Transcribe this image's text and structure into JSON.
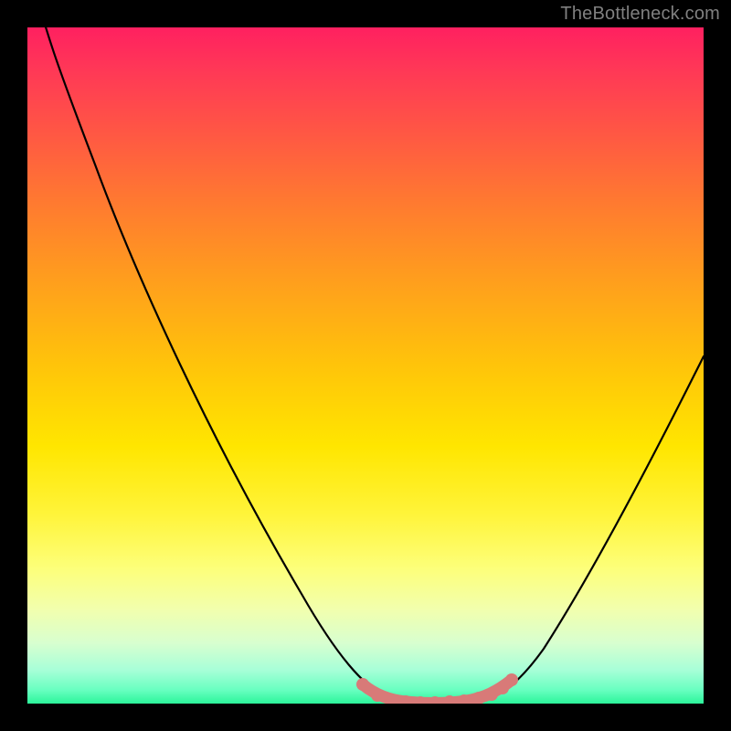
{
  "watermark": "TheBottleneck.com",
  "chart_data": {
    "type": "line",
    "title": "",
    "xlabel": "",
    "ylabel": "",
    "xlim": [
      0,
      100
    ],
    "ylim": [
      0,
      100
    ],
    "series": [
      {
        "name": "curve",
        "x": [
          0,
          4,
          10,
          18,
          26,
          34,
          42,
          48,
          52,
          56,
          58,
          60,
          64,
          68,
          72,
          76,
          82,
          88,
          94,
          100
        ],
        "y": [
          110,
          100,
          86,
          69,
          52,
          36,
          20,
          8,
          2,
          0,
          0,
          0,
          0,
          0,
          1,
          4,
          12,
          23,
          37,
          53
        ]
      }
    ],
    "highlight": {
      "name": "bottom-highlight",
      "color": "#d87a78",
      "points_x": [
        49,
        52,
        54,
        56,
        58,
        60,
        62,
        64,
        66,
        68,
        70,
        71.5
      ],
      "points_y": [
        3,
        1,
        0.5,
        0.3,
        0.2,
        0.2,
        0.2,
        0.3,
        0.5,
        1,
        2,
        3.5
      ]
    },
    "gradient_stops": [
      {
        "pct": 0,
        "color": "#ff2060"
      },
      {
        "pct": 15,
        "color": "#ff5545"
      },
      {
        "pct": 38,
        "color": "#ffa01c"
      },
      {
        "pct": 62,
        "color": "#ffe600"
      },
      {
        "pct": 86,
        "color": "#f2ffad"
      },
      {
        "pct": 100,
        "color": "#2cf59a"
      }
    ]
  }
}
